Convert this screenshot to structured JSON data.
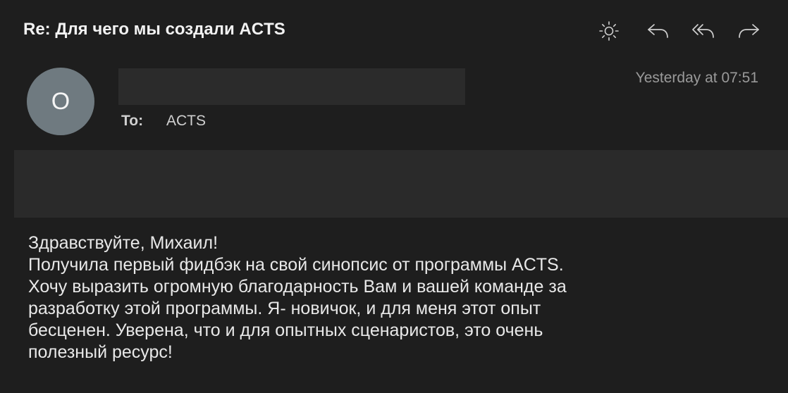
{
  "message": {
    "subject": "Re: Для чего мы создали ACTS",
    "sender_initial": "O",
    "to_label": "To:",
    "to_value": "ACTS",
    "date": "Yesterday at 07:51",
    "body_lines": [
      "Здравствуйте, Михаил!",
      "Получила первый фидбэк на свой синопсис от программы ACTS.",
      "Хочу выразить огромную благодарность Вам и вашей команде за",
      "разработку этой программы. Я- новичок, и для меня этот опыт",
      "бесценен. Уверена, что и для опытных сценаристов, это очень",
      "полезный ресурс!"
    ]
  },
  "toolbar": {
    "icons": [
      "brightness-icon",
      "reply-icon",
      "reply-all-icon",
      "forward-icon"
    ]
  },
  "colors": {
    "background": "#1e1e1e",
    "avatar": "#6f7a80",
    "redacted": "#2b2b2b",
    "icon": "#cfcfcf"
  }
}
